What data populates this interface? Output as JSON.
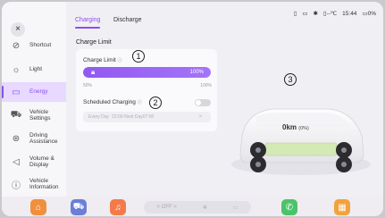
{
  "sidebar": {
    "close_icon": "×",
    "items": [
      {
        "label": "Shortcut",
        "icon": "link-icon",
        "glyph": "⊘"
      },
      {
        "label": "Light",
        "icon": "light-icon",
        "glyph": "☼"
      },
      {
        "label": "Energy",
        "icon": "battery-icon",
        "glyph": "▭"
      },
      {
        "label": "Vehicle\nSettings",
        "icon": "car-icon",
        "glyph": "⛟"
      },
      {
        "label": "Driving\nAssistance",
        "icon": "steering-icon",
        "glyph": "⊛"
      },
      {
        "label": "Volume &\nDisplay",
        "icon": "speaker-icon",
        "glyph": "◁"
      },
      {
        "label": "Vehicle\nInformation",
        "icon": "info-icon",
        "glyph": "ⓘ"
      }
    ],
    "active_index": 2
  },
  "tabs": {
    "charging": "Charging",
    "discharge": "Discharge"
  },
  "status": {
    "temp": "--℃",
    "time": "15:44",
    "battery": "0%"
  },
  "section_title": "Charge Limit",
  "charge_limit": {
    "label": "Charge Limit",
    "value_label": "100%",
    "value_fraction": 1.0,
    "min_label": "50%",
    "max_label": "100%"
  },
  "scheduled": {
    "label": "Scheduled Charging",
    "enabled": false,
    "row_days": "Every Day",
    "row_time": "22:00-Next Day07:00",
    "chevron": ">"
  },
  "callouts": [
    "1",
    "2",
    "3"
  ],
  "range": {
    "value": "0km",
    "percent": "(0%)"
  },
  "dock": {
    "climate_off": "< OFF >"
  },
  "colors": {
    "accent": "#8a4ff0",
    "home": "#f08f3e",
    "car": "#6a7fd9",
    "music": "#f47a4a",
    "phone": "#4cc36a",
    "apps": "#f2a23c"
  }
}
